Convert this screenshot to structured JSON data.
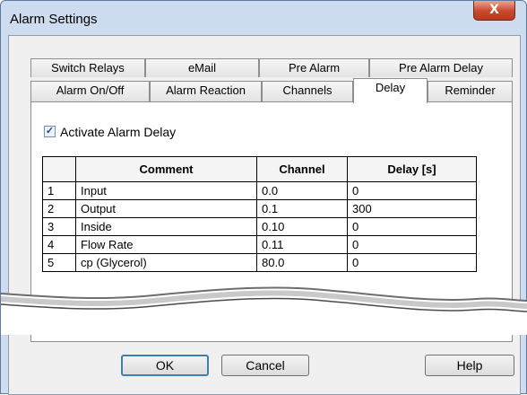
{
  "window": {
    "title": "Alarm Settings",
    "close_glyph": "X"
  },
  "tabs_row1": [
    "Switch Relays",
    "eMail",
    "Pre Alarm",
    "Pre Alarm Delay"
  ],
  "tabs_row2": [
    "Alarm On/Off",
    "Alarm Reaction",
    "Channels",
    "Delay",
    "Reminder"
  ],
  "active_tab": "Delay",
  "activate_delay": {
    "label": "Activate Alarm Delay",
    "checked": true
  },
  "table": {
    "headers": [
      "Comment",
      "Channel",
      "Delay [s]"
    ],
    "rows": [
      {
        "index": "1",
        "comment": "Input",
        "channel": "0.0",
        "delay": "0"
      },
      {
        "index": "2",
        "comment": "Output",
        "channel": "0.1",
        "delay": "300"
      },
      {
        "index": "3",
        "comment": "Inside",
        "channel": "0.10",
        "delay": "0"
      },
      {
        "index": "4",
        "comment": "Flow Rate",
        "channel": "0.11",
        "delay": "0"
      },
      {
        "index": "5",
        "comment": "cp (Glycerol)",
        "channel": "80.0",
        "delay": "0"
      }
    ]
  },
  "buttons": {
    "ok": "OK",
    "cancel": "Cancel",
    "help": "Help"
  }
}
